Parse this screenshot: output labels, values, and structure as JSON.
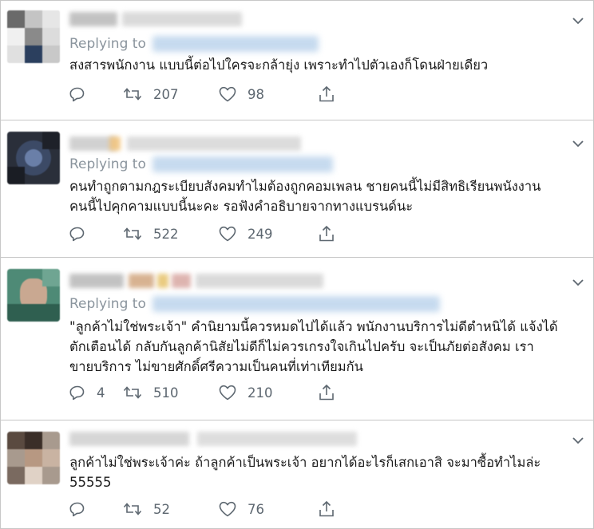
{
  "common": {
    "replying_label": "Replying to"
  },
  "tweets": [
    {
      "text": "สงสารพนักงาน แบบนี้ต่อไปใครจะกล้ายุ่ง เพราะทำไปตัวเองก็โดนฝ่ายเดียว",
      "replies": "",
      "retweets": "207",
      "likes": "98"
    },
    {
      "text": "คนทำถูกตามกฎระเบียบสังคมทำไมต้องถูกคอมเพลน ชายคนนี้ไม่มีสิทธิเรียนพนังงาน\nคนนี้ไปคุกคามแบบนี้นะคะ รอฟังคำอธิบายจากทางแบรนด์นะ",
      "replies": "",
      "retweets": "522",
      "likes": "249"
    },
    {
      "text": "\"ลูกค้าไม่ใช่พระเจ้า\" คำนิยามนี้ควรหมดไปได้แล้ว พนักงานบริการไม่ดีตำหนิได้ แจ้งได้\nตักเตือนได้ กลับกันลูกค้านิสัยไม่ดีก็ไม่ควรเกรงใจเกินไปครับ จะเป็นภัยต่อสังคม เรา\nขายบริการ ไม่ขายศักดิ์ศรีความเป็นคนที่เท่าเทียมกัน",
      "replies": "4",
      "retweets": "510",
      "likes": "210"
    },
    {
      "text": "ลูกค้าไม่ใช่พระเจ้าค่ะ ถ้าลูกค้าเป็นพระเจ้า อยากได้อะไรก็เสกเอาสิ จะมาซื้อทำไมล่ะ\n55555",
      "replies": "",
      "retweets": "52",
      "likes": "76"
    }
  ],
  "icons": {
    "reply": "reply-icon",
    "retweet": "retweet-icon",
    "like": "heart-icon",
    "share": "share-icon",
    "more": "chevron-down-icon"
  },
  "colors": {
    "text": "#1a1a1a",
    "muted": "#8a949d",
    "action": "#5d6770",
    "blur_link": "#bcd4ec"
  }
}
